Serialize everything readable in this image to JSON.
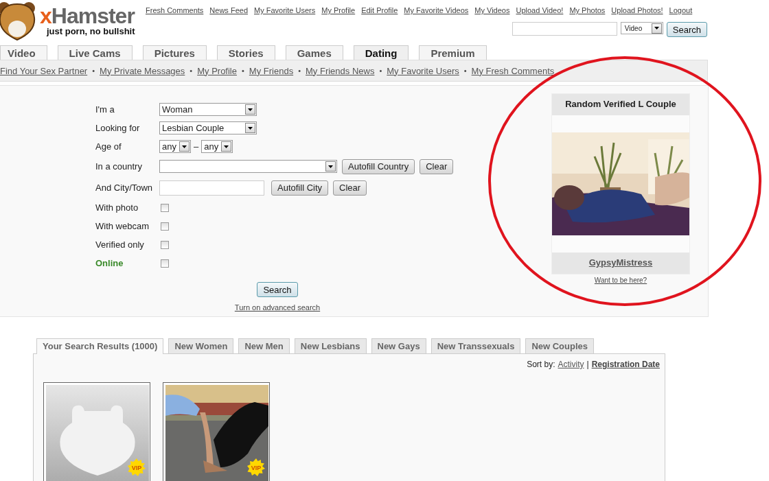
{
  "header": {
    "logo": {
      "brand_prefix": "x",
      "brand": "Hamster",
      "tagline": "just porn, no bullshit"
    },
    "top_links": [
      "Fresh Comments",
      "News Feed",
      "My Favorite Users",
      "My Profile",
      "Edit Profile",
      "My Favorite Videos",
      "My Videos",
      "Upload Video!",
      "My Photos",
      "Upload Photos!",
      "Logout"
    ],
    "search": {
      "type": "Video",
      "button": "Search"
    }
  },
  "main_tabs": [
    {
      "label": "Video",
      "selected": false
    },
    {
      "label": "Live Cams",
      "selected": false
    },
    {
      "label": "Pictures",
      "selected": false
    },
    {
      "label": "Stories",
      "selected": false
    },
    {
      "label": "Games",
      "selected": false
    },
    {
      "label": "Dating",
      "selected": true
    },
    {
      "label": "Premium",
      "selected": false
    }
  ],
  "sub_nav": {
    "separator": "•",
    "links": [
      "Find Your Sex Partner",
      "My Private Messages",
      "My Profile",
      "My Friends",
      "My Friends News",
      "My Favorite Users",
      "My Fresh Comments"
    ]
  },
  "search_form": {
    "fields": [
      {
        "kind": "select",
        "label": "I'm a",
        "value": "Woman"
      },
      {
        "kind": "select",
        "label": "Looking for",
        "value": "Lesbian Couple"
      },
      {
        "kind": "range",
        "label": "Age of",
        "from": "any",
        "separator": "–",
        "to": "any"
      },
      {
        "kind": "select_buttons",
        "label": "In a country",
        "buttons": [
          "Autofill Country",
          "Clear"
        ]
      },
      {
        "kind": "text_buttons",
        "label": "And City/Town",
        "buttons": [
          "Autofill City",
          "Clear"
        ]
      },
      {
        "kind": "checkbox",
        "label": "With photo",
        "checked": false
      },
      {
        "kind": "checkbox",
        "label": "With webcam",
        "checked": false
      },
      {
        "kind": "checkbox",
        "label": "Verified only",
        "checked": false
      },
      {
        "kind": "checkbox",
        "label": "Online",
        "checked": false,
        "color": "#3a8a2a"
      }
    ],
    "submit": "Search",
    "advanced_link": "Turn on advanced search"
  },
  "featured": {
    "title": "Random Verified L Couple",
    "name": "GypsyMistress",
    "link": "Want to be here?"
  },
  "results": {
    "tabs": [
      {
        "label": "Your Search Results (1000)",
        "selected": true
      },
      {
        "label": "New Women",
        "selected": false
      },
      {
        "label": "New Men",
        "selected": false
      },
      {
        "label": "New Lesbians",
        "selected": false
      },
      {
        "label": "New Gays",
        "selected": false
      },
      {
        "label": "New Transsexuals",
        "selected": false
      },
      {
        "label": "New Couples",
        "selected": false
      }
    ],
    "sort_label": "Sort by:",
    "sort_separator": "|",
    "sort_options": [
      {
        "label": "Activity",
        "selected": false
      },
      {
        "label": "Registration Date",
        "selected": true
      }
    ],
    "profiles": [
      {
        "kind": "placeholder",
        "badge": "VIP"
      },
      {
        "kind": "picture",
        "badge": "VIP"
      }
    ]
  },
  "annotation": {
    "kind": "ellipse",
    "color": "#e0141e"
  }
}
